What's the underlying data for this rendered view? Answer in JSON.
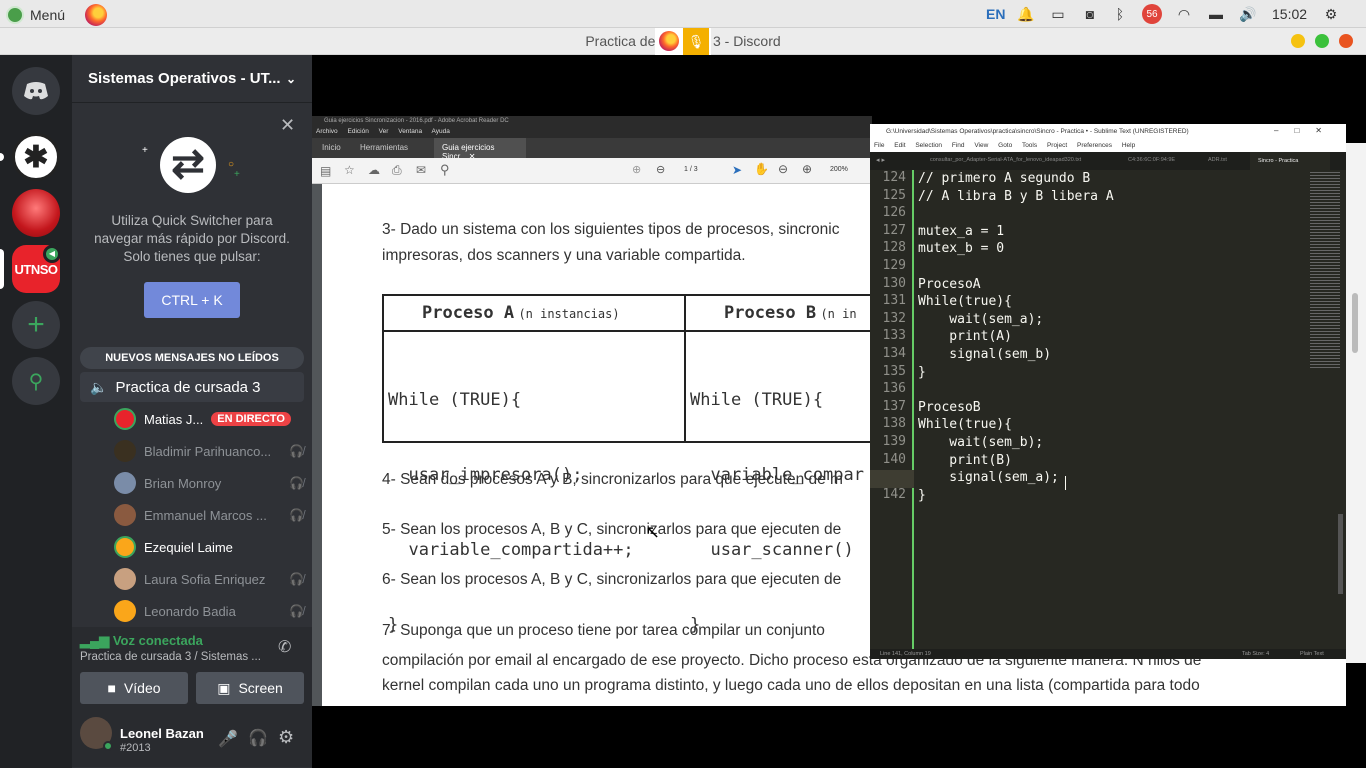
{
  "system": {
    "menu_label": "Menú",
    "lang": "EN",
    "notif_count": "56",
    "clock": "15:02"
  },
  "window": {
    "title": "Practica de cursada 3 - Discord"
  },
  "discord": {
    "server_name": "Sistemas Operativos - UT...",
    "quick_switcher_text": "Utiliza Quick Switcher para navegar más rápido por Discord. Solo tienes que pulsar:",
    "shortcut": "CTRL + K",
    "new_messages": "NUEVOS MENSAJES NO LEÍDOS",
    "voice_channel": "Practica de cursada 3",
    "live_badge": "EN DIRECTO",
    "users": [
      {
        "name": "Matias J..."
      },
      {
        "name": "Bladimir Parihuanco..."
      },
      {
        "name": "Brian Monroy"
      },
      {
        "name": "Emmanuel Marcos ..."
      },
      {
        "name": "Ezequiel Laime"
      },
      {
        "name": "Laura Sofia Enriquez"
      },
      {
        "name": "Leonardo Badia"
      }
    ],
    "voice_connected": "Voz conectada",
    "voice_path": "Practica de cursada 3 / Sistemas ...",
    "video_label": "Vídeo",
    "screen_label": "Screen",
    "username": "Leonel Bazan",
    "discriminator": "#2013",
    "guild_utn": "UTNSO"
  },
  "acrobat": {
    "title": "Guia ejercicios Sincronizacion - 2016.pdf - Adobe Acrobat Reader DC",
    "menu": [
      "Archivo",
      "Edición",
      "Ver",
      "Ventana",
      "Ayuda"
    ],
    "tabs": [
      "Inicio",
      "Herramientas",
      "Guia ejercicios Sincr..."
    ],
    "page_indicator": "1 / 3",
    "zoom": "200%",
    "p3": "3- Dado un sistema con los siguientes tipos de procesos, sincronic",
    "p3b": "impresoras, dos scanners y una variable compartida.",
    "proc_a_head": "Proceso A",
    "proc_a_sub": "(n instancias)",
    "proc_b_head": "Proceso B",
    "proc_b_sub": "(n in",
    "proc_a_code": [
      "While (TRUE){",
      "  usar_impresora();",
      "  variable_compartida++;",
      "}"
    ],
    "proc_b_code": [
      "While (TRUE){",
      "  variable_compar",
      "  usar_scanner()",
      "}"
    ],
    "p4": "4- Sean dos procesos A y B, sincronizarlos para que ejecuten de m",
    "p5": "5- Sean los procesos A, B y C, sincronizarlos para que ejecuten de",
    "p6": "6- Sean los procesos A, B y C, sincronizarlos para que ejecuten de",
    "p7": "7- Suponga que un proceso tiene por tarea compilar un conjunto",
    "p7b": "compilación por email al encargado de ese proyecto. Dicho proceso está organizado de la siguiente manera: N hilos de",
    "p7c": "kernel compilan cada uno un programa distinto, y luego cada uno de ellos depositan en una lista (compartida para todo"
  },
  "sublime": {
    "title": "G:\\Universidad\\Sistemas Operativos\\practica\\sincro\\Sincro - Practica • - Sublime Text (UNREGISTERED)",
    "menu": [
      "File",
      "Edit",
      "Selection",
      "Find",
      "View",
      "Goto",
      "Tools",
      "Project",
      "Preferences",
      "Help"
    ],
    "tabs": [
      "consultar_por_Adapter-Serial-ATA_for_lenovo_ideapad320.txt",
      "C4:36:6C:0F:94:9E",
      "ADR.txt",
      "Sincro - Practica"
    ],
    "line_numbers": [
      "124",
      "125",
      "126",
      "127",
      "128",
      "129",
      "130",
      "131",
      "132",
      "133",
      "134",
      "135",
      "136",
      "137",
      "138",
      "139",
      "140",
      "141",
      "142"
    ],
    "lines": [
      "// primero A segundo B",
      "// A libra B y B libera A",
      "",
      "mutex_a = 1",
      "mutex_b = 0",
      "",
      "ProcesoA",
      "While(true){",
      "    wait(sem_a);",
      "    print(A)",
      "    signal(sem_b)",
      "}",
      "",
      "ProcesoB",
      "While(true){",
      "    wait(sem_b);",
      "    print(B)",
      "    signal(sem_a);",
      "}"
    ],
    "status_left": "Line 141, Column 19",
    "status_tab": "Tab Size: 4",
    "status_syntax": "Plain Text"
  }
}
